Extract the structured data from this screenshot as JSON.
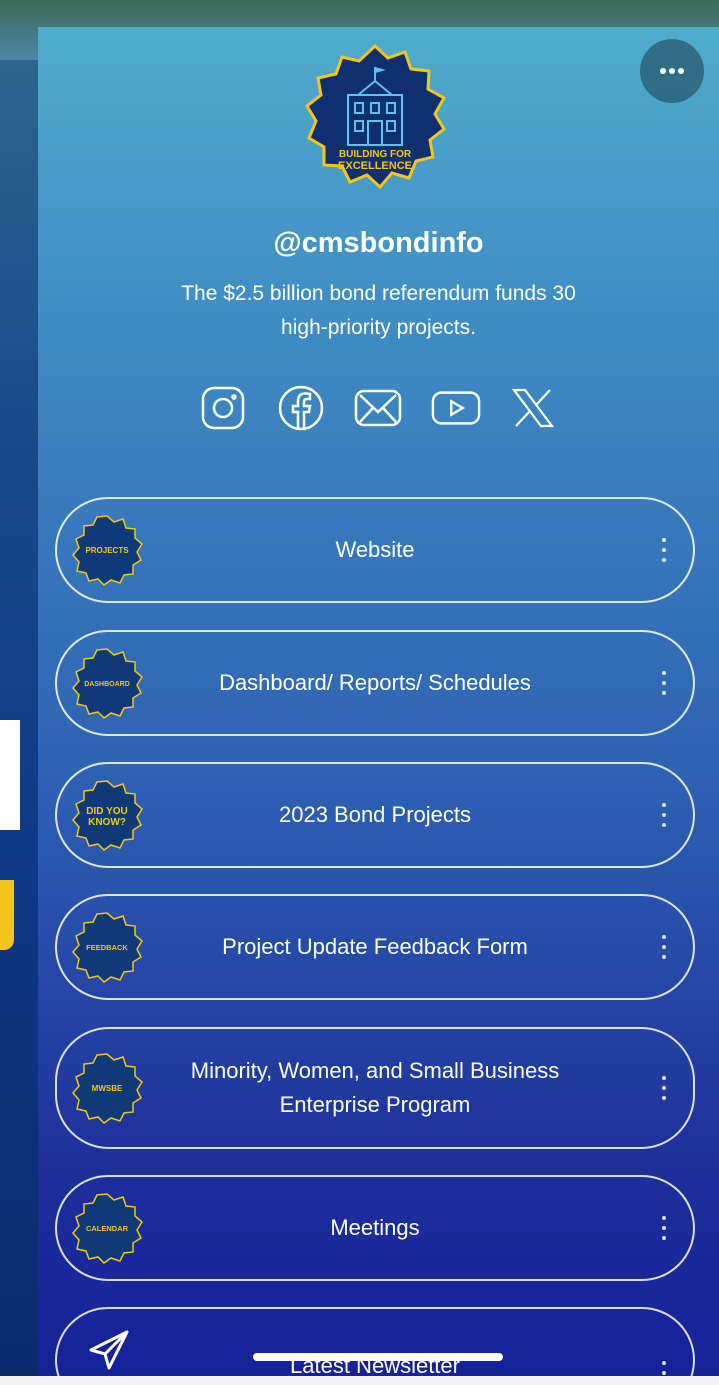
{
  "profile": {
    "logo_text_line1": "BUILDING FOR",
    "logo_text_line2": "EXCELLENCE",
    "handle": "@cmsbondinfo",
    "bio": "The $2.5 billion bond referendum funds 30 high-priority projects."
  },
  "socials": [
    "instagram-icon",
    "facebook-icon",
    "email-icon",
    "youtube-icon",
    "x-icon"
  ],
  "links": [
    {
      "label": "Website",
      "badge": "PROJECTS"
    },
    {
      "label": "Dashboard/ Reports/ Schedules",
      "badge": "DASHBOARD"
    },
    {
      "label": "2023 Bond Projects",
      "badge_line1": "DID YOU",
      "badge_line2": "KNOW?"
    },
    {
      "label": "Project Update Feedback Form",
      "badge": "FEEDBACK"
    },
    {
      "label": "Minority, Women, and Small Business Enterprise Program",
      "badge": "MWSBE"
    },
    {
      "label": "Meetings",
      "badge": "CALENDAR"
    },
    {
      "label": "Latest Newsletter"
    }
  ],
  "colors": {
    "badge_fill": "#0f3a78",
    "badge_border": "#f4c51a",
    "accent_yellow": "#f4c51a"
  }
}
